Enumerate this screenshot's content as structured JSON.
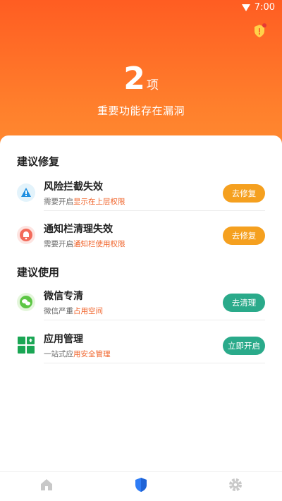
{
  "status_bar": {
    "time": "7:00",
    "icons": [
      "wifi-icon",
      "battery-icon"
    ]
  },
  "header": {
    "alert_icon": "shield-alert-icon",
    "count": "2",
    "count_unit": "项",
    "subtitle": "重要功能存在漏洞"
  },
  "sections": [
    {
      "title": "建议修复",
      "items": [
        {
          "icon": "risk-intercept-icon",
          "title": "风险拦截失效",
          "desc_prefix": "需要开启",
          "desc_highlight": "显示在上层权限",
          "button": "去修复"
        },
        {
          "icon": "notification-bell-icon",
          "title": "通知栏清理失效",
          "desc_prefix": "需要开启",
          "desc_highlight": "通知栏使用权限",
          "button": "去修复"
        }
      ]
    },
    {
      "title": "建议使用",
      "items": [
        {
          "icon": "wechat-icon",
          "title": "微信专清",
          "desc_prefix": "微信严重",
          "desc_highlight": "占用空间",
          "button": "去清理"
        },
        {
          "icon": "app-manage-icon",
          "title": "应用管理",
          "desc_prefix": "一站式应",
          "desc_highlight": "用安全管理",
          "button": "立即开启"
        }
      ]
    }
  ],
  "tabbar": {
    "items": [
      {
        "icon": "home-icon",
        "active": false
      },
      {
        "icon": "shield-icon",
        "active": true
      },
      {
        "icon": "gear-icon",
        "active": false
      }
    ]
  },
  "colors": {
    "hero_top": "#ff5d22",
    "hero_bottom": "#ff8a30",
    "fix_button": "#f5a01f",
    "use_button": "#2aaa8a",
    "highlight_text": "#f0632a",
    "active_tab": "#2f7df6",
    "inactive_tab": "#c8c8c8"
  }
}
